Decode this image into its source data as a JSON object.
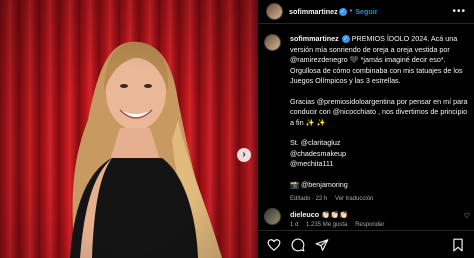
{
  "post": {
    "username": "sofimmartinez",
    "follow_label": "Seguir",
    "more_label": "•••",
    "separator": "•"
  },
  "caption": {
    "username": "sofimmartinez",
    "text_1": "PREMIOS ÍDOLO 2024. Acá una versión mía sonriendo de oreja a oreja vestida por @ramirezdenegro 🖤 *jamás imaginé decir eso*. Orgullosa de cómo combinaba con mis tatuajes de los Juegos Olímpicos y las 3 estrellas.",
    "text_2": "Gracias @premiosidoloargentina por pensar en mí para conducir con @nicocchiato , nos divertimos de principio a fin ✨ ✨",
    "credits": [
      "St. @claritagluz",
      "@chadesmakeup",
      "@mechita111"
    ],
    "photo_credit": "📸 @benjamoring",
    "edited": "Editado · 22 h",
    "translate": "Ver traducción"
  },
  "comment": {
    "username": "dieleuco",
    "text": "👏🏻👏🏻👏🏻",
    "age": "1 d",
    "likes": "1.235 Me gusta",
    "reply": "Responder"
  },
  "icons": {
    "like": "heart-icon",
    "comment": "comment-icon",
    "share": "share-icon",
    "save": "bookmark-icon",
    "next": "chevron-right-icon"
  },
  "colors": {
    "accent": "#0095f6",
    "verified": "#3897f0",
    "curtain": "#b8161b"
  }
}
